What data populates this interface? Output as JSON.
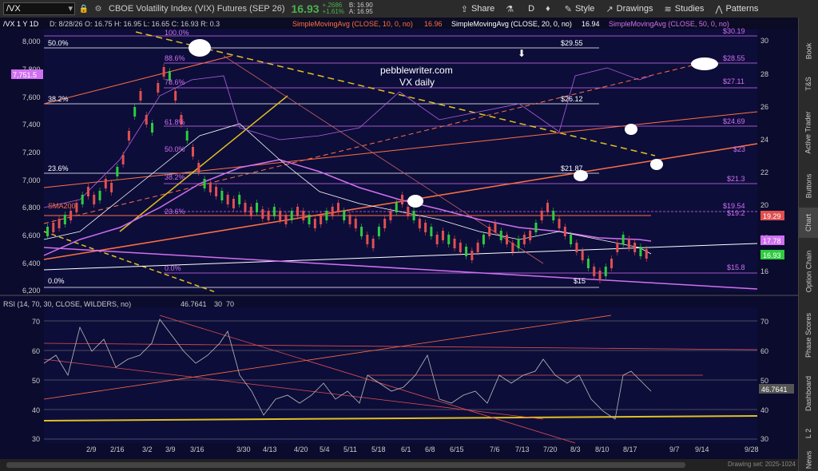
{
  "toolbar": {
    "symbol": "/VX",
    "description": "CBOE Volatility Index (VIX) Futures (SEP 26)",
    "last": "16.93",
    "change": "+.2686",
    "change_pct": "+1.61%",
    "bid": "B: 16.90",
    "ask": "A: 16.95",
    "share": "Share",
    "aggregation": "D",
    "style": "Style",
    "drawings": "Drawings",
    "studies": "Studies",
    "patterns": "Patterns"
  },
  "chart_header": {
    "symbol": "/VX 1 Y 1D",
    "ohlc": "D: 8/28/26  O: 16.75  H: 16.95  L: 16.65  C: 16.93  R: 0.3",
    "sma10": "SimpleMovingAvg (CLOSE, 10, 0, no)",
    "sma10_val": "16.96",
    "sma20": "SimpleMovingAvg (CLOSE, 20, 0, no)",
    "sma20_val": "16.94",
    "sma50": "SimpleMovingAvg (CLOSE, 50, 0, no)"
  },
  "left_axis_labels": [
    "8,000",
    "7,800",
    "7,600",
    "7,400",
    "7,200",
    "7,000",
    "6,800",
    "6,600",
    "6,400",
    "6,200"
  ],
  "left_badge": "7,751.5",
  "right_axis_labels": [
    "30",
    "28",
    "26",
    "24",
    "22",
    "20",
    "18",
    "16"
  ],
  "price_badges": {
    "b1": "19.29",
    "b2": "17.78",
    "b3": "16.93"
  },
  "annotations": {
    "brand": "pebblewriter.com",
    "subtitle": "VX daily",
    "sma200": "SMA200",
    "fib": [
      "100.0%",
      "88.6%",
      "78.6%",
      "61.8%",
      "50.0%",
      "38.2%",
      "23.6%",
      "0.0%"
    ],
    "fib_left": [
      "50.0%",
      "38.2%",
      "23.6%",
      "0.0%"
    ],
    "levels": [
      "$30.19",
      "$29.55",
      "$28.55",
      "$27.11",
      "$26.12",
      "$24.69",
      "$23",
      "$21.87",
      "$21.3",
      "$19.54",
      "$19.2",
      "$15.8",
      "$15"
    ]
  },
  "rsi": {
    "header": "RSI (14, 70, 30, CLOSE, WILDERS, no)",
    "value": "46.7641",
    "ob": "30",
    "os": "70",
    "axis": [
      "70",
      "60",
      "50",
      "40",
      "30"
    ]
  },
  "x_axis": [
    "2/9",
    "2/16",
    "3/2",
    "3/9",
    "3/16",
    "3/30",
    "4/13",
    "4/20",
    "5/4",
    "5/11",
    "5/18",
    "6/1",
    "6/8",
    "6/15",
    "7/6",
    "7/13",
    "7/20",
    "8/3",
    "8/10",
    "8/17",
    "9/7",
    "9/14",
    "9/28"
  ],
  "sidebar": [
    "News",
    "L 2",
    "Dashboard",
    "Times & Sales",
    "Phase Scores",
    "Option Chain",
    "Chart",
    "Buttons",
    "Active Trader",
    "T&S",
    "Book"
  ],
  "drawing_set": "Drawing set: 2025-1024",
  "colors": {
    "bg": "#0b0b2e",
    "up": "#2ecc40",
    "down": "#e05050",
    "fib": "#ffffff",
    "magenta": "#d070f0",
    "orange": "#ff7043",
    "yellow": "#e0c020",
    "rsi": "#bbbbbb"
  }
}
